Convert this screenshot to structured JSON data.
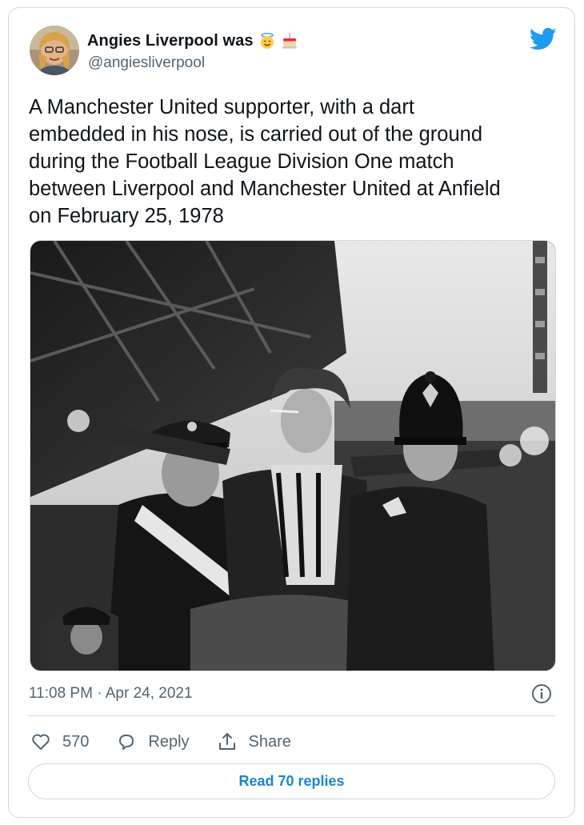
{
  "tweet": {
    "display_name": "Angies Liverpool was",
    "name_emojis": [
      "smiling-face-with-halo-emoji",
      "birthday-cake-emoji"
    ],
    "handle": "@angiesliverpool",
    "text": "A Manchester United supporter, with a dart\nembedded in his nose, is carried out of the ground\nduring the Football League Division One match\nbetween Liverpool and Manchester United at Anfield\non February 25, 1978",
    "timestamp": "11:08 PM · Apr 24, 2021",
    "likes_count": "570",
    "reply_label": "Reply",
    "share_label": "Share",
    "read_replies_label": "Read 70 replies"
  },
  "icons": {
    "platform_logo": "twitter-bird-icon",
    "info": "info-icon",
    "like": "heart-icon",
    "reply": "speech-bubble-icon",
    "share": "share-upload-icon"
  },
  "colors": {
    "brand_blue": "#1d9bf0",
    "link_blue": "#1b86d0",
    "secondary_text": "#536471",
    "border": "#cfd9de"
  }
}
